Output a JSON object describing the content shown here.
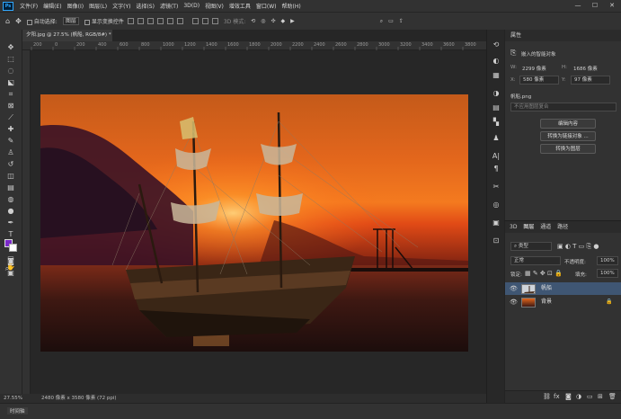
{
  "menu": [
    "文件(F)",
    "编辑(E)",
    "图像(I)",
    "图层(L)",
    "文字(Y)",
    "选择(S)",
    "滤镜(T)",
    "3D(D)",
    "视图(V)",
    "增效工具",
    "窗口(W)",
    "帮助(H)"
  ],
  "window_controls": {
    "minimize": "—",
    "maximize": "☐",
    "close": "✕"
  },
  "options": {
    "auto_select": "自动选择:",
    "auto_select_target": "图层",
    "show_transform": "显示变换控件",
    "three_d_mode": "3D 模式:"
  },
  "doc_tab": "夕阳.jpg @ 27.5% (帆船, RGB/8#) *",
  "ruler_ticks": [
    "200",
    "0",
    "200",
    "400",
    "600",
    "800",
    "1000",
    "1200",
    "1400",
    "1600",
    "1800",
    "2000",
    "2200",
    "2400",
    "2600",
    "2800",
    "3000",
    "3200",
    "3400",
    "3600",
    "3800",
    "4000"
  ],
  "status": {
    "zoom": "27.55%",
    "doc": "2480 像素 x 3580 像素 (72 ppi)"
  },
  "timeline": "时间轴",
  "properties": {
    "tab": "属性",
    "type": "嵌入的智能对象",
    "w_label": "W:",
    "w_value": "2299 像素",
    "h_label": "H:",
    "h_value": "1686 像素",
    "x_label": "X:",
    "x_value": "580 像素",
    "y_label": "Y:",
    "y_value": "97 像素",
    "filename": "帆船.png",
    "comp_placeholder": "不应用图层复合",
    "btn_edit": "编辑内容",
    "btn_linked": "转换为链接对象 ...",
    "btn_layers": "转换为图层"
  },
  "layers": {
    "tabs": [
      "3D",
      "图层",
      "通道",
      "路径"
    ],
    "filter": "类型",
    "blend": "正常",
    "opacity_label": "不透明度:",
    "opacity": "100%",
    "lock_label": "锁定:",
    "fill_label": "填充:",
    "fill": "100%",
    "items": [
      {
        "name": "帆船"
      },
      {
        "name": "背景"
      }
    ]
  },
  "colors": {
    "foreground": "#7a28c8",
    "background": "#ffffff",
    "selection": "#3f5673"
  }
}
